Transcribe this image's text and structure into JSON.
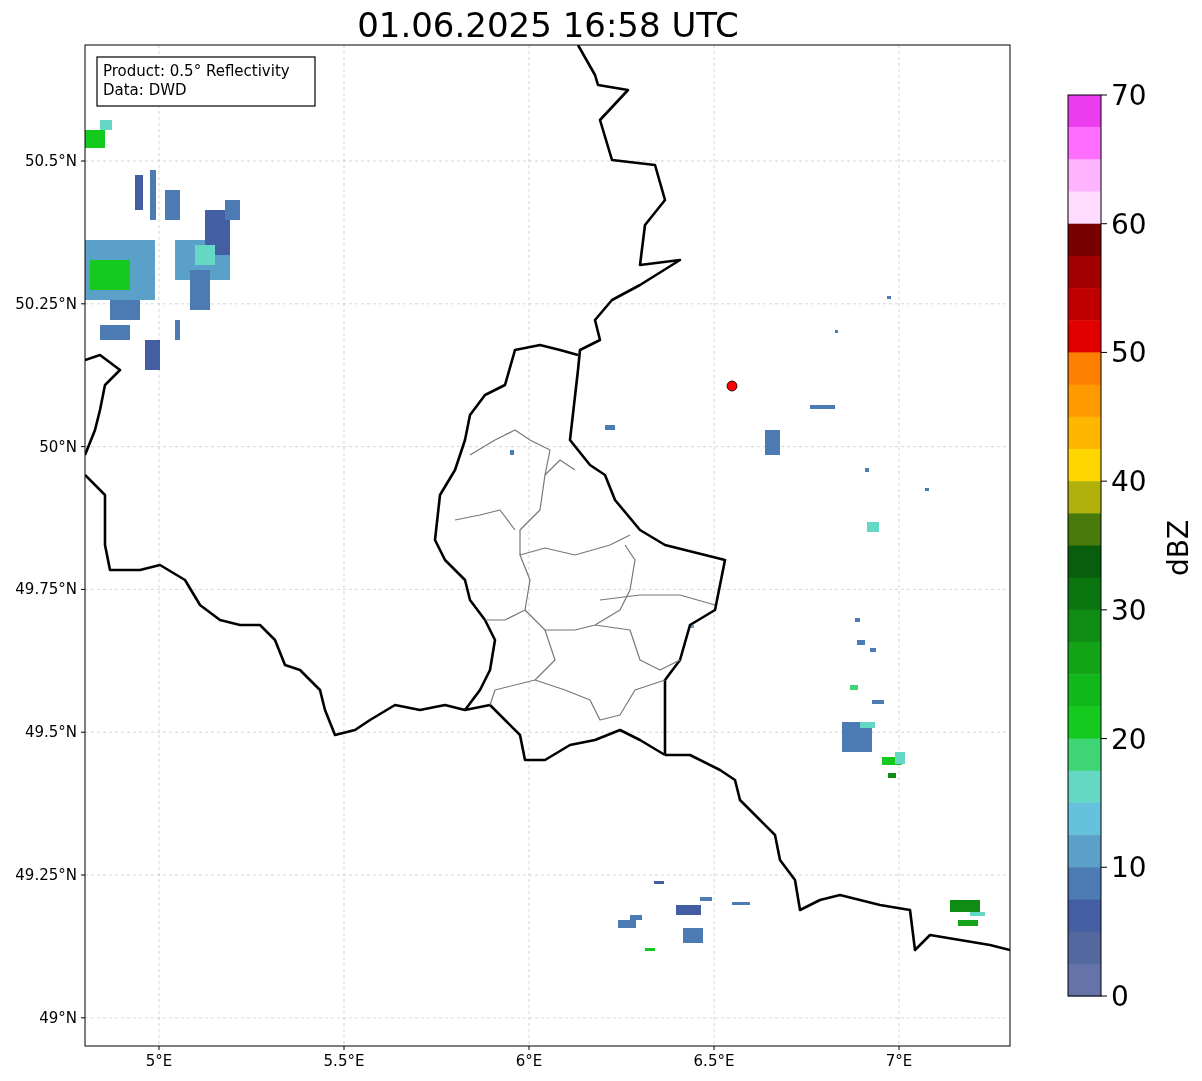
{
  "title": "01.06.2025 16:58 UTC",
  "info_box": [
    "Product: 0.5° Reflectivity",
    "Data: DWD"
  ],
  "map": {
    "xticks": [
      "5°E",
      "5.5°E",
      "6°E",
      "6.5°E",
      "7°E"
    ],
    "yticks": [
      "50.5°N",
      "50.25°N",
      "50°N",
      "49.75°N",
      "49.5°N",
      "49.25°N",
      "49°N"
    ]
  },
  "colorbar": {
    "label": "dBZ",
    "ticks": [
      "70",
      "60",
      "50",
      "40",
      "30",
      "20",
      "10",
      "0"
    ],
    "bands": [
      {
        "color": "#eb3cf0"
      },
      {
        "color": "#ff6eff"
      },
      {
        "color": "#ffb4ff"
      },
      {
        "color": "#ffdcff"
      },
      {
        "color": "#780000"
      },
      {
        "color": "#a00000"
      },
      {
        "color": "#c00000"
      },
      {
        "color": "#e10000"
      },
      {
        "color": "#ff7f00"
      },
      {
        "color": "#ff9900"
      },
      {
        "color": "#ffb600"
      },
      {
        "color": "#ffd700"
      },
      {
        "color": "#b0b10a"
      },
      {
        "color": "#497a0b"
      },
      {
        "color": "#085e0c"
      },
      {
        "color": "#0b7610"
      },
      {
        "color": "#0f8c14"
      },
      {
        "color": "#12a416"
      },
      {
        "color": "#10b81a"
      },
      {
        "color": "#14ca1e"
      },
      {
        "color": "#3ed674"
      },
      {
        "color": "#64d8c4"
      },
      {
        "color": "#66c2dc"
      },
      {
        "color": "#5aa0c8"
      },
      {
        "color": "#4b7bb2"
      },
      {
        "color": "#435ea2"
      },
      {
        "color": "#5468a0"
      },
      {
        "color": "#6673a8"
      }
    ]
  }
}
